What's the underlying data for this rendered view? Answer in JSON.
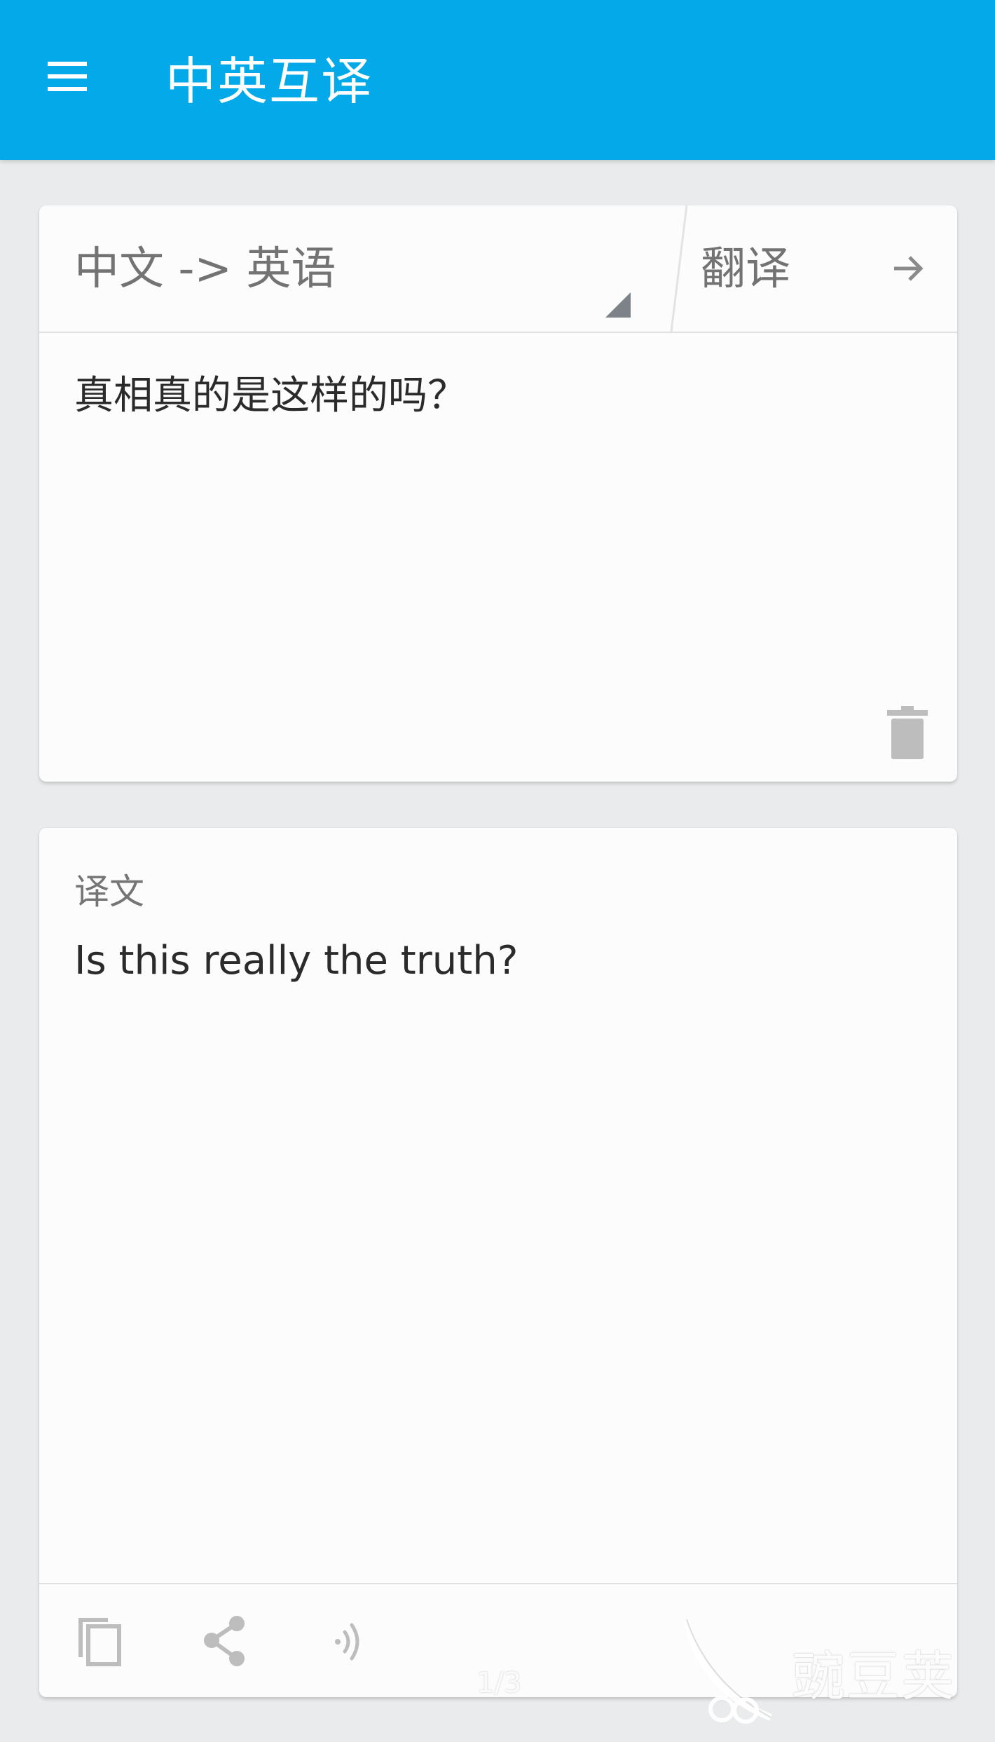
{
  "app_bar": {
    "title": "中英互译",
    "menu_icon": "hamburger-menu-icon",
    "background_color": "#03a9e9"
  },
  "input_card": {
    "language_selector": "中文 -> 英语",
    "translate_label": "翻译",
    "translate_icon": "arrow-right-icon",
    "source_text": "真相真的是这样的吗？",
    "clear_icon": "trash-icon"
  },
  "output_card": {
    "label": "译文",
    "translated_text": "Is this really the truth?",
    "actions": {
      "copy_icon": "copy-icon",
      "share_icon": "share-icon",
      "speak_icon": "speaker-icon"
    }
  },
  "overlay": {
    "watermark_text": "豌豆荚",
    "page_indicator": "1/3"
  }
}
